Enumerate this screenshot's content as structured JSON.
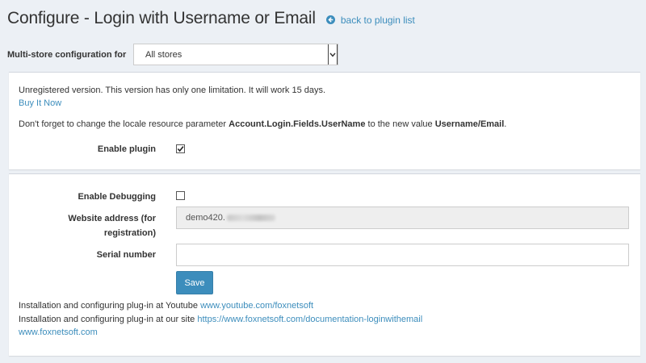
{
  "header": {
    "title": "Configure - Login with Username or Email",
    "back_link": "back to plugin list",
    "back_icon": "arrow-circle-left-icon"
  },
  "store": {
    "label": "Multi-store configuration for",
    "selected": "All stores"
  },
  "notice": {
    "unregistered": "Unregistered version. This version has only one limitation. It will work 15 days.",
    "buy_link": "Buy It Now",
    "locale_prefix": "Don't forget to change the locale resource parameter ",
    "locale_param": "Account.Login.Fields.UserName",
    "locale_middle": " to the new value ",
    "locale_value": "Username/Email",
    "locale_suffix": "."
  },
  "settings": {
    "enable_plugin_label": "Enable plugin",
    "enable_plugin_checked": true,
    "enable_debugging_label": "Enable Debugging",
    "enable_debugging_checked": false,
    "website_label_line1": "Website address (for",
    "website_label_line2": "registration)",
    "website_value": "demo420.",
    "serial_label": "Serial number",
    "serial_value": "",
    "save_label": "Save"
  },
  "footer": {
    "youtube_prefix": "Installation and configuring plug-in at Youtube ",
    "youtube_link": "www.youtube.com/foxnetsoft",
    "site_prefix": "Installation and configuring plug-in at our site ",
    "site_link": "https://www.foxnetsoft.com/documentation-loginwithemail",
    "home_link": "www.foxnetsoft.com"
  },
  "colors": {
    "accent": "#3c8dbc",
    "background": "#ecf0f5"
  }
}
